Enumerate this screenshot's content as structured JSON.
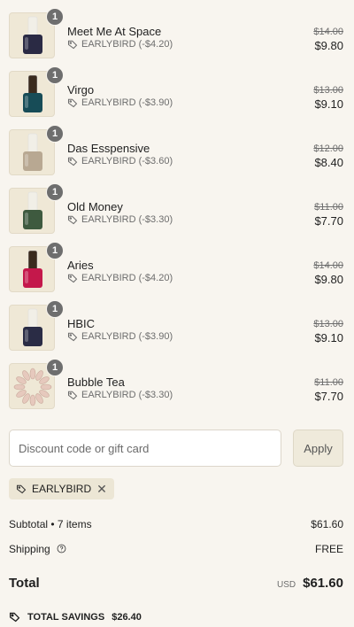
{
  "items": [
    {
      "qty": "1",
      "name": "Meet Me At Space",
      "discount": "EARLYBIRD (-$4.20)",
      "original": "$14.00",
      "price": "$9.80",
      "color": "#2a2a44",
      "cap": "#f1efe7",
      "bg": "#efe8d6"
    },
    {
      "qty": "1",
      "name": "Virgo",
      "discount": "EARLYBIRD (-$3.90)",
      "original": "$13.00",
      "price": "$9.10",
      "color": "#174c57",
      "cap": "#3a2b1e",
      "bg": "#efe8d6"
    },
    {
      "qty": "1",
      "name": "Das Esspensive",
      "discount": "EARLYBIRD (-$3.60)",
      "original": "$12.00",
      "price": "$8.40",
      "color": "#b8a892",
      "cap": "#f1efe7",
      "bg": "#efe8d6"
    },
    {
      "qty": "1",
      "name": "Old Money",
      "discount": "EARLYBIRD (-$3.30)",
      "original": "$11.00",
      "price": "$7.70",
      "color": "#3e5a3f",
      "cap": "#f1efe7",
      "bg": "#efe8d6"
    },
    {
      "qty": "1",
      "name": "Aries",
      "discount": "EARLYBIRD (-$4.20)",
      "original": "$14.00",
      "price": "$9.80",
      "color": "#c4184b",
      "cap": "#3a2b1e",
      "bg": "#efe8d6"
    },
    {
      "qty": "1",
      "name": "HBIC",
      "discount": "EARLYBIRD (-$3.90)",
      "original": "$13.00",
      "price": "$9.10",
      "color": "#2a2c45",
      "cap": "#f1efe7",
      "bg": "#efe8d6"
    },
    {
      "qty": "1",
      "name": "Bubble Tea",
      "discount": "EARLYBIRD (-$3.30)",
      "original": "$11.00",
      "price": "$7.70",
      "color": "#e6c9bd",
      "cap": "#f1efe7",
      "bg": "#efe8d6",
      "kind": "press-on"
    }
  ],
  "discount": {
    "placeholder": "Discount code or gift card",
    "apply_label": "Apply",
    "applied_code": "EARLYBIRD",
    "remove_glyph": "✕"
  },
  "summary": {
    "subtotal_label": "Subtotal • 7 items",
    "subtotal_value": "$61.60",
    "shipping_label": "Shipping",
    "shipping_value": "FREE",
    "total_label": "Total",
    "currency": "USD",
    "total_value": "$61.60",
    "savings_label": "TOTAL SAVINGS",
    "savings_value": "$26.40"
  },
  "icons": {
    "tag": "tag-icon",
    "help": "help-circle-icon",
    "savings": "savings-tag-icon",
    "close": "close-icon"
  }
}
